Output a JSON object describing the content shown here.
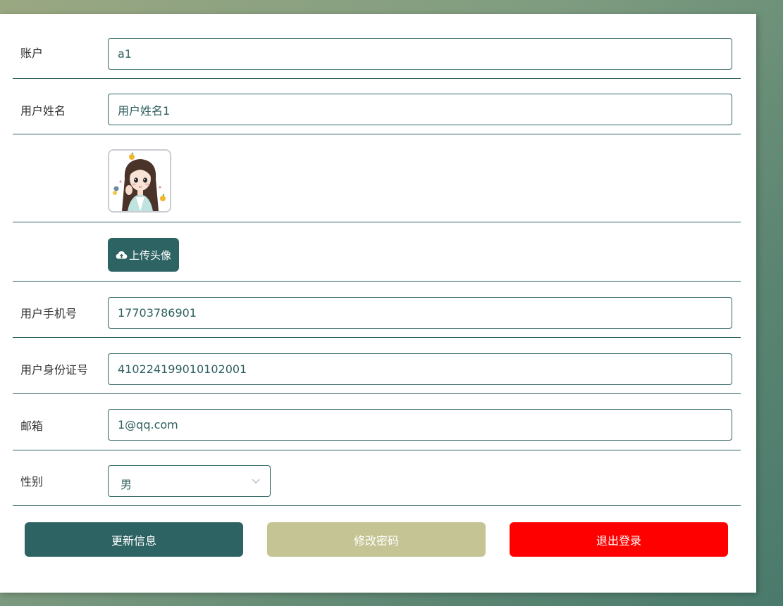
{
  "form": {
    "account": {
      "label": "账户",
      "value": "a1"
    },
    "username": {
      "label": "用户姓名",
      "value": "用户姓名1"
    },
    "avatar": {
      "label": ""
    },
    "upload": {
      "label": "上传头像",
      "icon": "cloud-upload-icon"
    },
    "phone": {
      "label": "用户手机号",
      "value": "17703786901"
    },
    "idcard": {
      "label": "用户身份证号",
      "value": "410224199010102001"
    },
    "email": {
      "label": "邮箱",
      "value": "1@qq.com"
    },
    "gender": {
      "label": "性别",
      "value": "男"
    }
  },
  "actions": {
    "update": "更新信息",
    "password": "修改密码",
    "logout": "退出登录"
  },
  "colors": {
    "primary": "#2e6363",
    "secondary": "#c4c494",
    "danger": "#ff0000"
  }
}
